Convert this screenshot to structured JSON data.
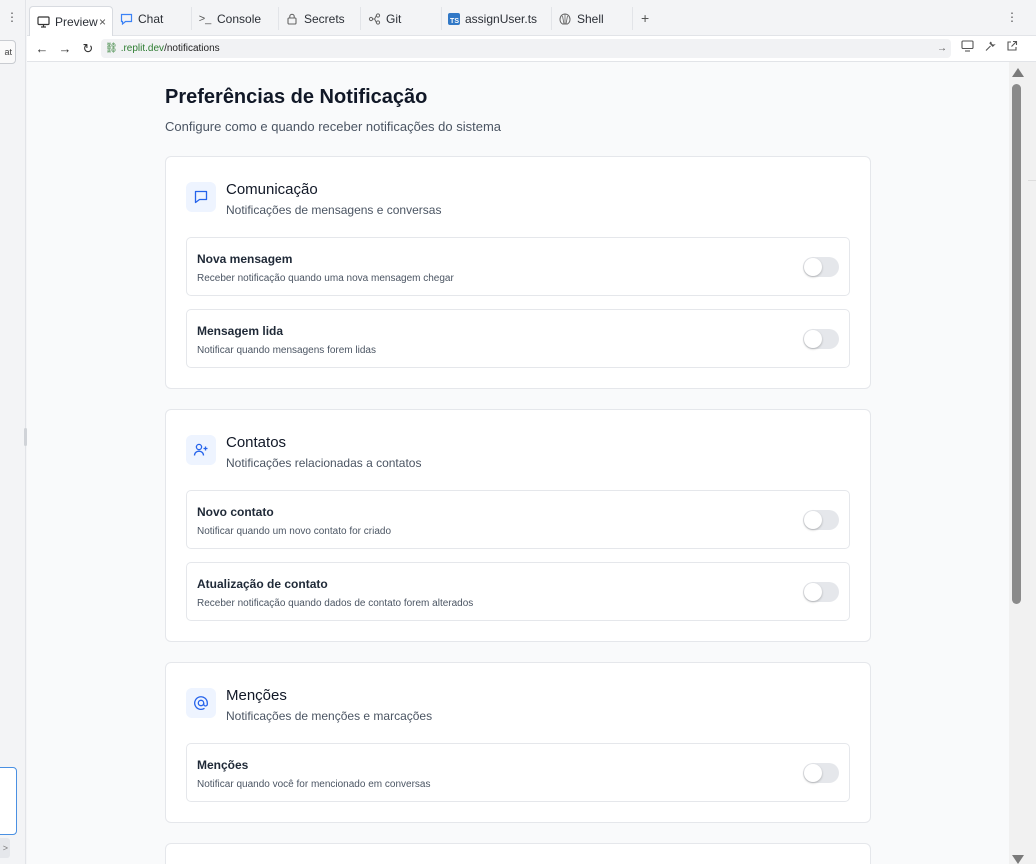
{
  "left_panel": {
    "chat_fragment": "at",
    "send_fragment": ">"
  },
  "tabs": [
    {
      "label": "Preview",
      "icon": "monitor-icon",
      "active": true,
      "closable": true
    },
    {
      "label": "Chat",
      "icon": "chat-icon"
    },
    {
      "label": "Console",
      "icon": "terminal-icon"
    },
    {
      "label": "Secrets",
      "icon": "lock-icon"
    },
    {
      "label": "Git",
      "icon": "git-branch-icon"
    },
    {
      "label": "assignUser.ts",
      "icon": "typescript-file-icon",
      "badge": "TS"
    },
    {
      "label": "Shell",
      "icon": "shell-icon"
    }
  ],
  "tabbar": {
    "add": "+",
    "more": "⋮"
  },
  "address": {
    "domain": ".replit.dev",
    "path": "/notifications"
  },
  "page": {
    "title": "Preferências de Notificação",
    "subtitle": "Configure como e quando receber notificações do sistema"
  },
  "sections": [
    {
      "icon": "message-square-icon",
      "title": "Comunicação",
      "description": "Notificações de mensagens e conversas",
      "items": [
        {
          "title": "Nova mensagem",
          "description": "Receber notificação quando uma nova mensagem chegar",
          "enabled": false
        },
        {
          "title": "Mensagem lida",
          "description": "Notificar quando mensagens forem lidas",
          "enabled": false
        }
      ]
    },
    {
      "icon": "user-plus-icon",
      "title": "Contatos",
      "description": "Notificações relacionadas a contatos",
      "items": [
        {
          "title": "Novo contato",
          "description": "Notificar quando um novo contato for criado",
          "enabled": false
        },
        {
          "title": "Atualização de contato",
          "description": "Receber notificação quando dados de contato forem alterados",
          "enabled": false
        }
      ]
    },
    {
      "icon": "at-sign-icon",
      "title": "Menções",
      "description": "Notificações de menções e marcações",
      "items": [
        {
          "title": "Menções",
          "description": "Notificar quando você for mencionado em conversas",
          "enabled": false
        }
      ]
    }
  ],
  "colors": {
    "accent": "#2563eb",
    "toggle_off": "#e5e7eb",
    "url_green": "#2e7d32"
  }
}
